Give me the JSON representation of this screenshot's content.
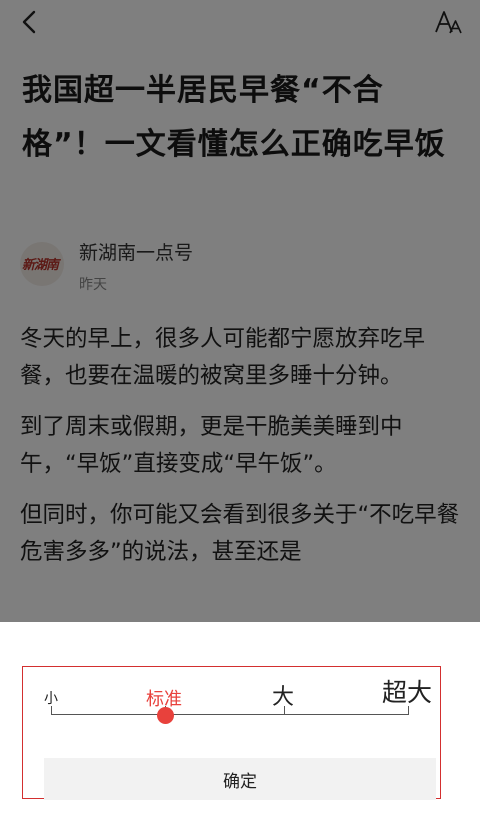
{
  "article": {
    "title": "我国超一半居民早餐“不合格”！一文看懂怎么正确吃早饭",
    "author": {
      "name": "新湖南一点号",
      "time": "昨天",
      "avatar_logo_text": "新湖南"
    },
    "paragraphs": [
      "冬天的早上，很多人可能都宁愿放弃吃早餐，也要在温暖的被窝里多睡十分钟。",
      "到了周末或假期，更是干脆美美睡到中午，“早饭”直接变成“早午饭”。",
      "但同时，你可能又会看到很多关于“不吃早餐危害多多”的说法，甚至还是"
    ]
  },
  "topbar": {
    "back_icon": "chevron-left-icon",
    "font_size_icon": "font-size-icon"
  },
  "font_size_sheet": {
    "options": [
      "小",
      "标准",
      "大",
      "超大"
    ],
    "selected": "标准",
    "selected_index": 1,
    "confirm_label": "确定"
  },
  "colors": {
    "accent": "#e8413c",
    "highlight_border": "#d32f2f",
    "overlay": "rgba(0,0,0,0.5)"
  }
}
